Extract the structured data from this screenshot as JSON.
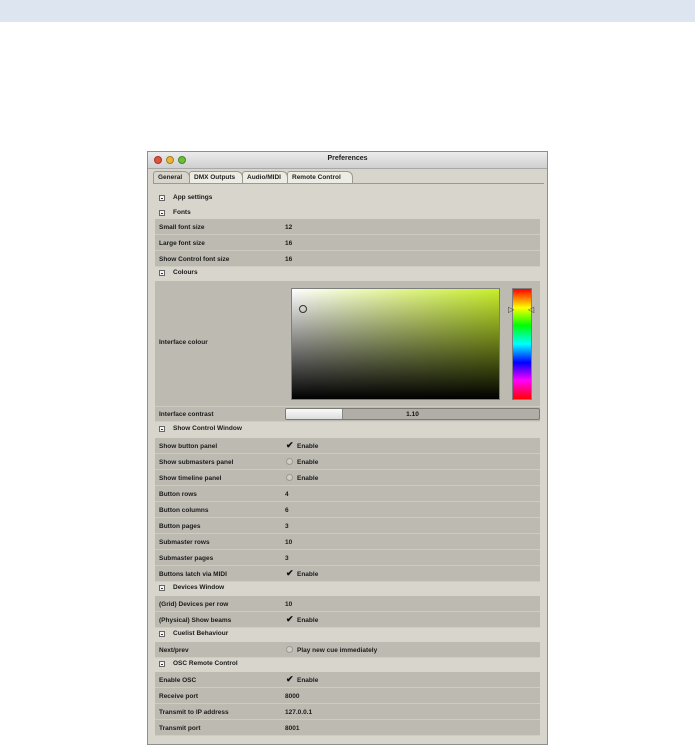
{
  "window": {
    "title": "Preferences",
    "tabs": [
      "General",
      "DMX Outputs",
      "Audio/MIDI",
      "Remote Control"
    ]
  },
  "sections": {
    "app": {
      "title": "App settings"
    },
    "fonts": {
      "title": "Fonts",
      "small": {
        "label": "Small font size",
        "value": "12"
      },
      "large": {
        "label": "Large font size",
        "value": "16"
      },
      "showcontrol": {
        "label": "Show Control font size",
        "value": "16"
      }
    },
    "colours": {
      "title": "Colours",
      "interface_colour": {
        "label": "Interface colour",
        "colour": "#c8ee2a"
      },
      "interface_contrast": {
        "label": "Interface contrast",
        "value": "1.10",
        "level": 0.22
      }
    },
    "showcontrol": {
      "title": "Show Control Window",
      "button_panel": {
        "label": "Show button panel",
        "option": "Enable",
        "checked": true
      },
      "submasters_panel": {
        "label": "Show submasters panel",
        "option": "Enable",
        "checked": false
      },
      "timeline_panel": {
        "label": "Show timeline panel",
        "option": "Enable",
        "checked": false
      },
      "button_rows": {
        "label": "Button rows",
        "value": "4"
      },
      "button_columns": {
        "label": "Button columns",
        "value": "6"
      },
      "button_pages": {
        "label": "Button pages",
        "value": "3"
      },
      "submaster_rows": {
        "label": "Submaster rows",
        "value": "10"
      },
      "submaster_pages": {
        "label": "Submaster pages",
        "value": "3"
      },
      "latch_midi": {
        "label": "Buttons latch via MIDI",
        "option": "Enable",
        "checked": true
      }
    },
    "devices": {
      "title": "Devices Window",
      "per_row": {
        "label": "(Grid) Devices per row",
        "value": "10"
      },
      "show_beams": {
        "label": "(Physical) Show beams",
        "option": "Enable",
        "checked": true
      }
    },
    "cuelist": {
      "title": "Cuelist Behaviour",
      "next_prev": {
        "label": "Next/prev",
        "option": "Play new cue immediately",
        "checked": false
      }
    },
    "osc": {
      "title": "OSC Remote Control",
      "enable": {
        "label": "Enable OSC",
        "option": "Enable",
        "checked": true
      },
      "receive_port": {
        "label": "Receive port",
        "value": "8000"
      },
      "transmit_ip": {
        "label": "Transmit to IP address",
        "value": "127.0.0.1"
      },
      "transmit_port": {
        "label": "Transmit port",
        "value": "8001"
      }
    }
  }
}
